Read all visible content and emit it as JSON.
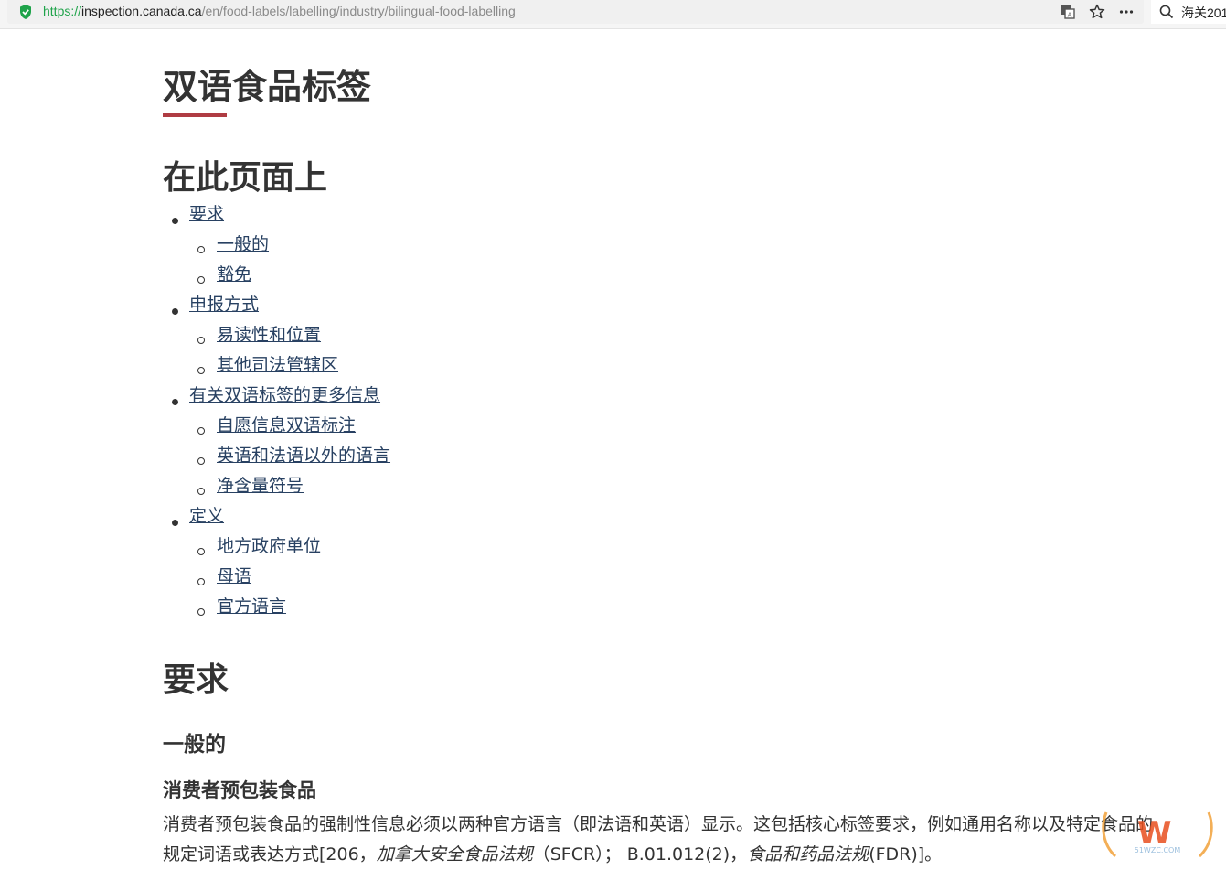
{
  "browser": {
    "url_scheme": "https://",
    "url_host": "inspection.canada.ca",
    "url_path": "/en/food-labels/labelling/industry/bilingual-food-labelling",
    "search_text": "海关201"
  },
  "page": {
    "title": "双语食品标签",
    "toc_heading": "在此页面上",
    "toc": [
      {
        "label": "要求",
        "children": [
          "一般的",
          "豁免"
        ]
      },
      {
        "label": "申报方式",
        "children": [
          "易读性和位置",
          "其他司法管辖区"
        ]
      },
      {
        "label": "有关双语标签的更多信息",
        "children": [
          "自愿信息双语标注",
          "英语和法语以外的语言",
          "净含量符号"
        ]
      },
      {
        "label": "定义",
        "children": [
          "地方政府单位",
          "母语",
          "官方语言"
        ]
      }
    ],
    "section_heading": "要求",
    "subsection_heading": "一般的",
    "subsubsection_heading": "消费者预包装食品",
    "paragraph": {
      "line1": "消费者预包装食品的强制性信息必须以两种官方语言（即法语和英语）显示。这包括核心标签要求，例如通用名称以及特定食品的",
      "line2_a": "规定词语或表达方式[206，",
      "line2_em1": "加拿大安全食品法规",
      "line2_b": "（SFCR）；  B.01.012(2)，",
      "line2_em2": "食品和药品法规",
      "line2_c": "(FDR)]。"
    }
  },
  "colors": {
    "accent_underline": "#af3c43",
    "link": "#284162",
    "secure_green": "#1fa34a"
  },
  "watermark": {
    "brand": "W",
    "text": "51WZC.COM"
  }
}
